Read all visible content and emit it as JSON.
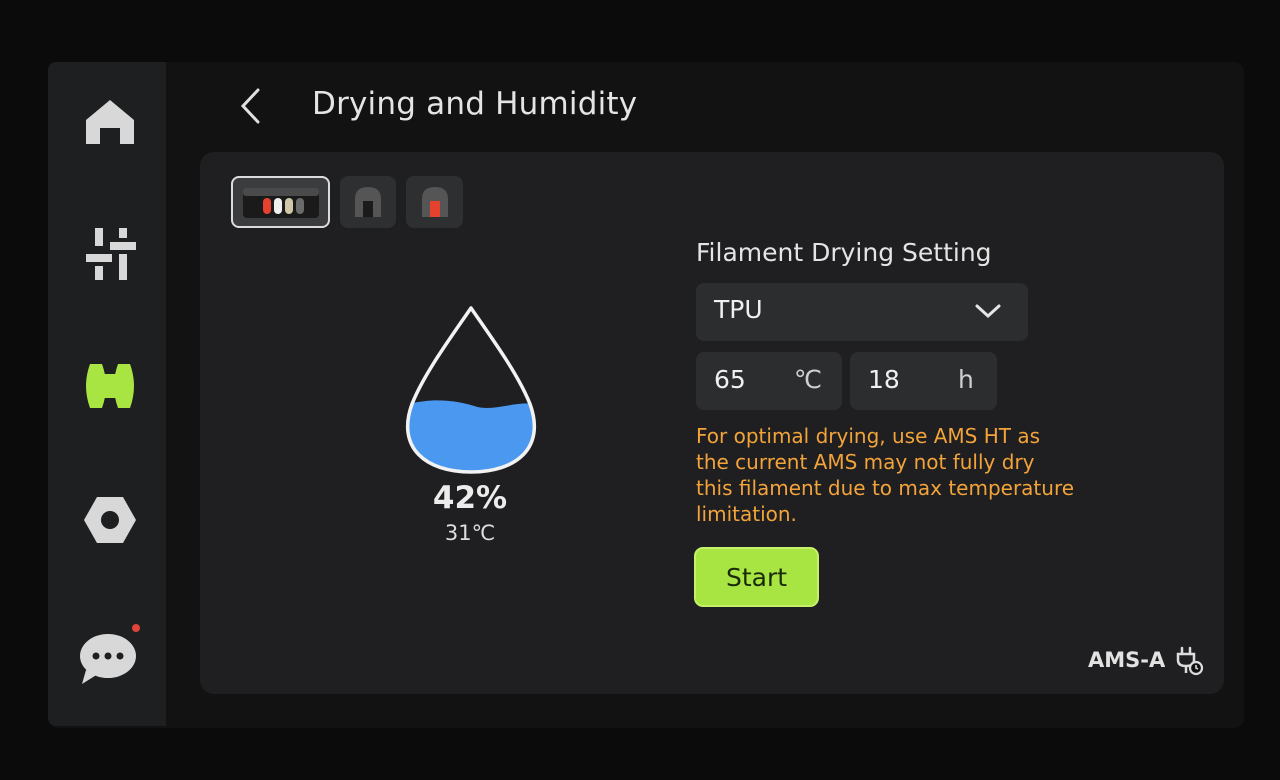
{
  "header": {
    "title": "Drying and Humidity"
  },
  "sidebar": {
    "items": [
      {
        "name": "home",
        "icon": "home-icon"
      },
      {
        "name": "controls",
        "icon": "sliders-icon"
      },
      {
        "name": "filament",
        "icon": "spool-icon",
        "active": true
      },
      {
        "name": "settings",
        "icon": "hex-nut-icon"
      },
      {
        "name": "messages",
        "icon": "chat-bubble-icon",
        "badge": true
      }
    ],
    "active_color": "#a8e542"
  },
  "ams_tabs": [
    {
      "name": "ams-4-slot",
      "icon": "ams-four-slot-icon",
      "active": true
    },
    {
      "name": "ams-ht-1",
      "icon": "ams-single-slot-icon"
    },
    {
      "name": "ams-ht-2",
      "icon": "ams-single-slot-red-icon"
    }
  ],
  "humidity": {
    "value": "42%",
    "temperature": "31℃",
    "fill_level": 0.42,
    "water_color": "#4a98ef"
  },
  "drying": {
    "section_title": "Filament Drying Setting",
    "material": "TPU",
    "temperature_value": "65",
    "temperature_unit": "℃",
    "time_value": "18",
    "time_unit": "h",
    "warning": "For optimal drying, use AMS HT as the current AMS may not fully dry this filament due to max temperature limitation.",
    "warning_color": "#f2a33a",
    "start_label": "Start",
    "start_color": "#a8e542"
  },
  "footer": {
    "ams_label": "AMS-A",
    "ams_icon": "power-plug-icon"
  }
}
